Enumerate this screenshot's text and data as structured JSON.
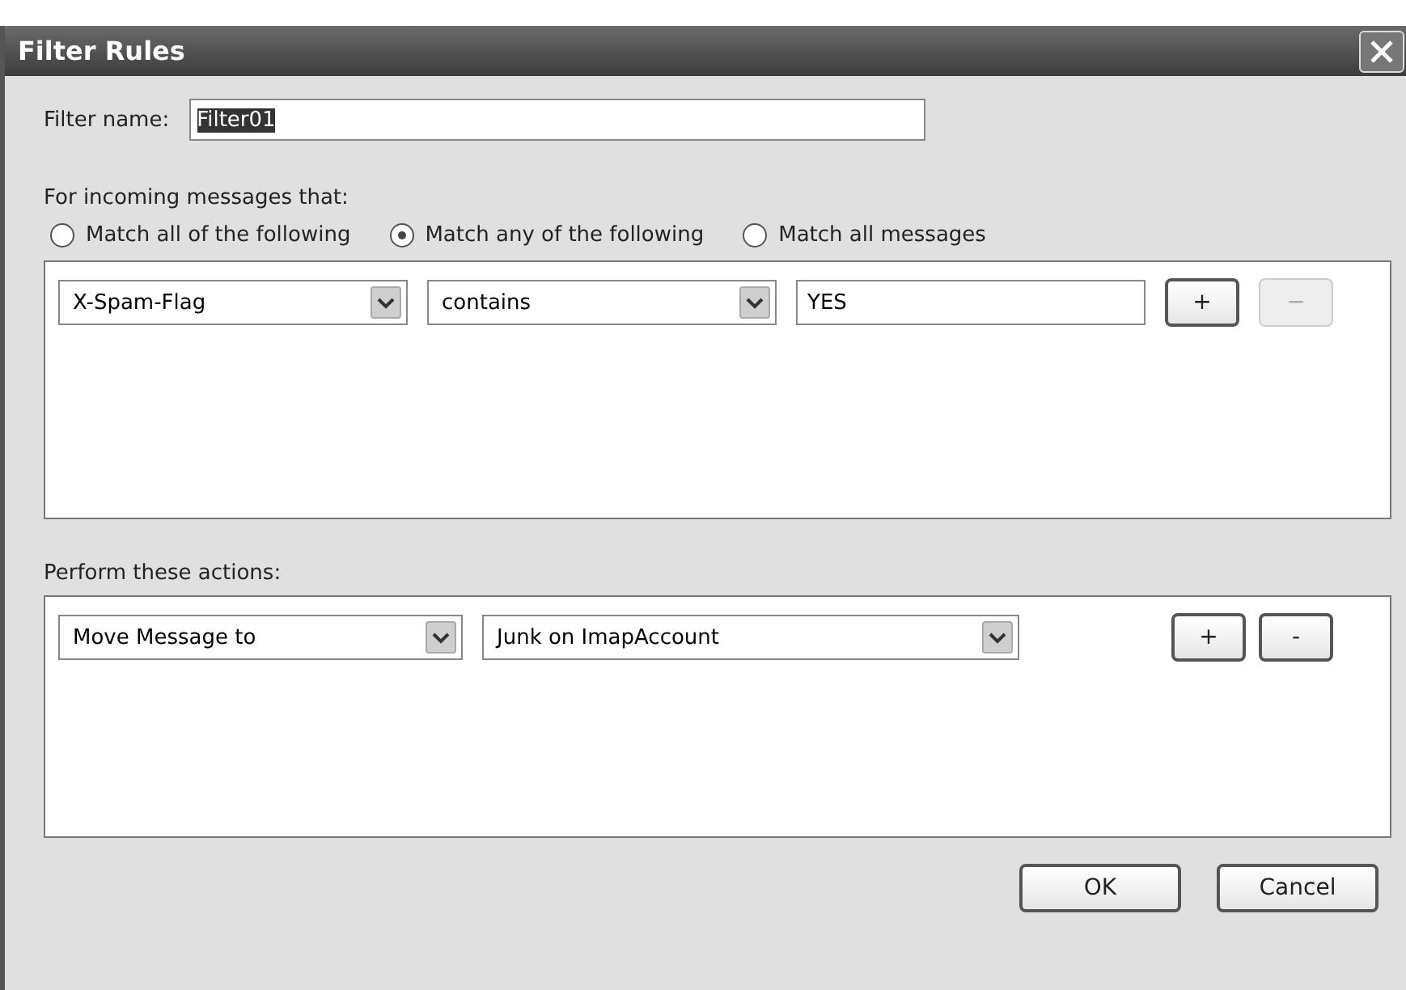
{
  "window": {
    "title": "Filter Rules"
  },
  "filter_name": {
    "label": "Filter name:",
    "value": "Filter01",
    "selected": true
  },
  "conditions": {
    "heading": "For incoming messages that:",
    "match_options": [
      {
        "label": "Match all of the following",
        "selected": false
      },
      {
        "label": "Match any of the following",
        "selected": true
      },
      {
        "label": "Match all messages",
        "selected": false
      }
    ],
    "rules": [
      {
        "field": "X-Spam-Flag",
        "operator": "contains",
        "value": "YES",
        "add": {
          "label": "+",
          "disabled": false
        },
        "remove": {
          "label": "−",
          "disabled": true
        }
      }
    ]
  },
  "actions": {
    "heading": "Perform these actions:",
    "rules": [
      {
        "action": "Move Message to",
        "target": "Junk on ImapAccount",
        "add": {
          "label": "+",
          "disabled": false
        },
        "remove": {
          "label": "-",
          "disabled": false
        }
      }
    ]
  },
  "buttons": [
    {
      "label": "OK"
    },
    {
      "label": "Cancel"
    }
  ]
}
